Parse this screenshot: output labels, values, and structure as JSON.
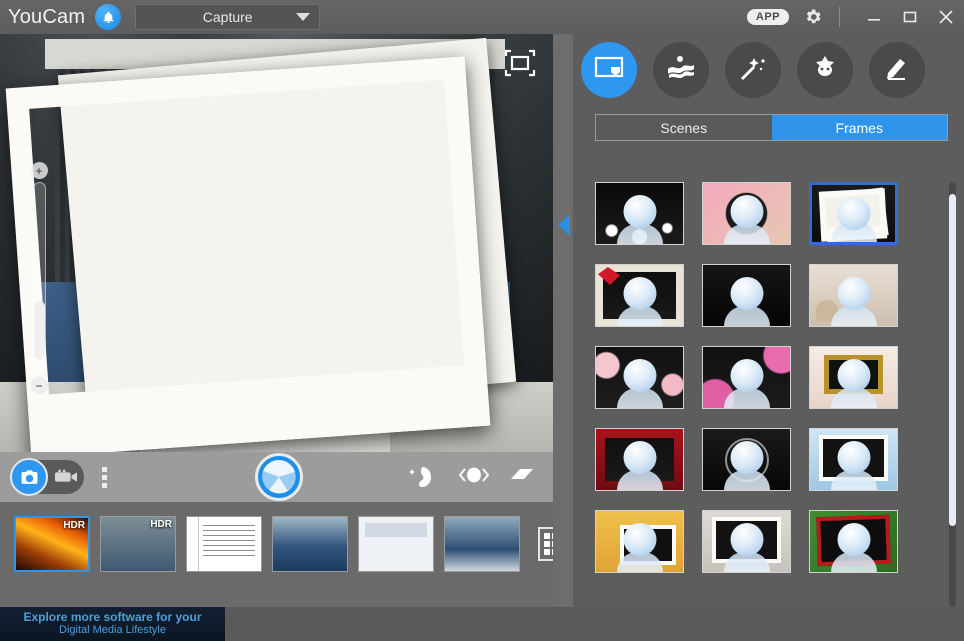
{
  "titlebar": {
    "brand": "YouCam",
    "bell_icon": "bell-icon",
    "mode_dropdown": "Capture",
    "app_badge": "APP",
    "gear_icon": "gear-icon",
    "minimize_icon": "minimize-icon",
    "maximize_icon": "maximize-icon",
    "close_icon": "close-icon"
  },
  "preview": {
    "fullscreen_icon": "fullscreen-icon",
    "zoom_in_label": "+",
    "zoom_out_label": "−"
  },
  "controlbar": {
    "photo_mode_icon": "camera-icon",
    "video_mode_icon": "camcorder-icon",
    "more_menu_icon": "more-options-icon",
    "shutter_icon": "shutter-icon",
    "skin_smoothener_icon": "skin-smoothener-icon",
    "eye_enhancer_icon": "eye-enhancer-icon",
    "blemish_eraser_icon": "blemish-eraser-icon"
  },
  "filmstrip": {
    "grid_view_icon": "grid-view-icon",
    "items": [
      {
        "name": "thumbnail-fire",
        "badge": "HDR",
        "selected": true,
        "style": "t-fire"
      },
      {
        "name": "thumbnail-globe",
        "badge": "HDR",
        "selected": false,
        "style": "t-globe"
      },
      {
        "name": "thumbnail-document",
        "badge": "",
        "selected": false,
        "style": "t-doc"
      },
      {
        "name": "thumbnail-man-headphones",
        "badge": "",
        "selected": false,
        "style": "t-man1"
      },
      {
        "name": "thumbnail-screenshot",
        "badge": "",
        "selected": false,
        "style": "t-screen"
      },
      {
        "name": "thumbnail-man-sunglasses",
        "badge": "",
        "selected": false,
        "style": "t-man2"
      }
    ]
  },
  "divider": {
    "collapse_icon": "collapse-panel-arrow-icon"
  },
  "right_panel": {
    "tabs": [
      {
        "label": "frames-tab",
        "icon": "frame-icon",
        "active": true
      },
      {
        "label": "effects-tab",
        "icon": "distortion-icon",
        "active": false
      },
      {
        "label": "magic-tab",
        "icon": "magic-wand-icon",
        "active": false
      },
      {
        "label": "avatar-tab",
        "icon": "avatar-icon",
        "active": false
      },
      {
        "label": "draw-tab",
        "icon": "pencil-icon",
        "active": false
      }
    ],
    "segments": [
      {
        "label": "Scenes",
        "active": false
      },
      {
        "label": "Frames",
        "active": true
      }
    ],
    "frames": [
      {
        "name": "frame-bokeh-lights",
        "selected": false,
        "bg": "radial-gradient(circle at 18% 78%, #ffffff 0 6%, transparent 8%), radial-gradient(circle at 82% 74%, #ffffff 0 5%, transparent 7%), radial-gradient(circle at 50% 88%, #dfeffb 0 10%, transparent 12%), linear-gradient(180deg,#0a0a0a,#1b1b1b)"
      },
      {
        "name": "frame-pink-heart",
        "selected": false,
        "bg": "radial-gradient(circle at 50% 50%, #1b1b1b 0 38%, transparent 40%), linear-gradient(135deg,#f3a9bd,#e8c7b2)"
      },
      {
        "name": "frame-polaroid",
        "selected": true,
        "bg": "linear-gradient(180deg,#1a1a1a,#0d0d0d)"
      },
      {
        "name": "frame-red-ribbon",
        "selected": false,
        "bg": "linear-gradient(180deg,#0d0d0d,#1a1a1a)"
      },
      {
        "name": "frame-camera-lens",
        "selected": false,
        "bg": "linear-gradient(180deg,#151515,#050505)"
      },
      {
        "name": "frame-incense",
        "selected": false,
        "bg": "linear-gradient(180deg,#e8ded4,#cdbfae)"
      },
      {
        "name": "frame-cherry-petals",
        "selected": false,
        "bg": "radial-gradient(circle at 12% 30%, #f6c6cf 0 14%, transparent 16%), radial-gradient(circle at 88% 62%, #f3b9c6 0 12%, transparent 14%), linear-gradient(180deg,#121212,#1d1d1d)"
      },
      {
        "name": "frame-pink-blossom",
        "selected": false,
        "bg": "radial-gradient(circle at 90% 14%, #e86bb0 0 18%, transparent 20%), radial-gradient(circle at 14% 84%, #e05fa4 0 20%, transparent 22%), linear-gradient(180deg,#101010,#1c1c1c)"
      },
      {
        "name": "frame-gold-picture",
        "selected": false,
        "bg": "linear-gradient(180deg,#f6ece4,#e7d4c8)"
      },
      {
        "name": "frame-red-roses",
        "selected": false,
        "bg": "linear-gradient(180deg,#a8131a,#6d0d12)"
      },
      {
        "name": "frame-crosshair",
        "selected": false,
        "bg": "linear-gradient(180deg,#1a1a1a,#070707)"
      },
      {
        "name": "frame-snow-photo",
        "selected": false,
        "bg": "linear-gradient(180deg,#cfe6f5,#9ec8e5)"
      },
      {
        "name": "frame-beach-sunset",
        "selected": false,
        "bg": "linear-gradient(180deg,#f1c24a,#e0a235)"
      },
      {
        "name": "frame-grunge-white",
        "selected": false,
        "bg": "linear-gradient(180deg,#dedbd6,#c6c2bb)"
      },
      {
        "name": "frame-green-red",
        "selected": false,
        "bg": "linear-gradient(135deg,#3f8f30,#2b6b21)"
      }
    ]
  },
  "banner": {
    "line1": "Explore more software for your",
    "line2": "Digital Media Lifestyle"
  }
}
